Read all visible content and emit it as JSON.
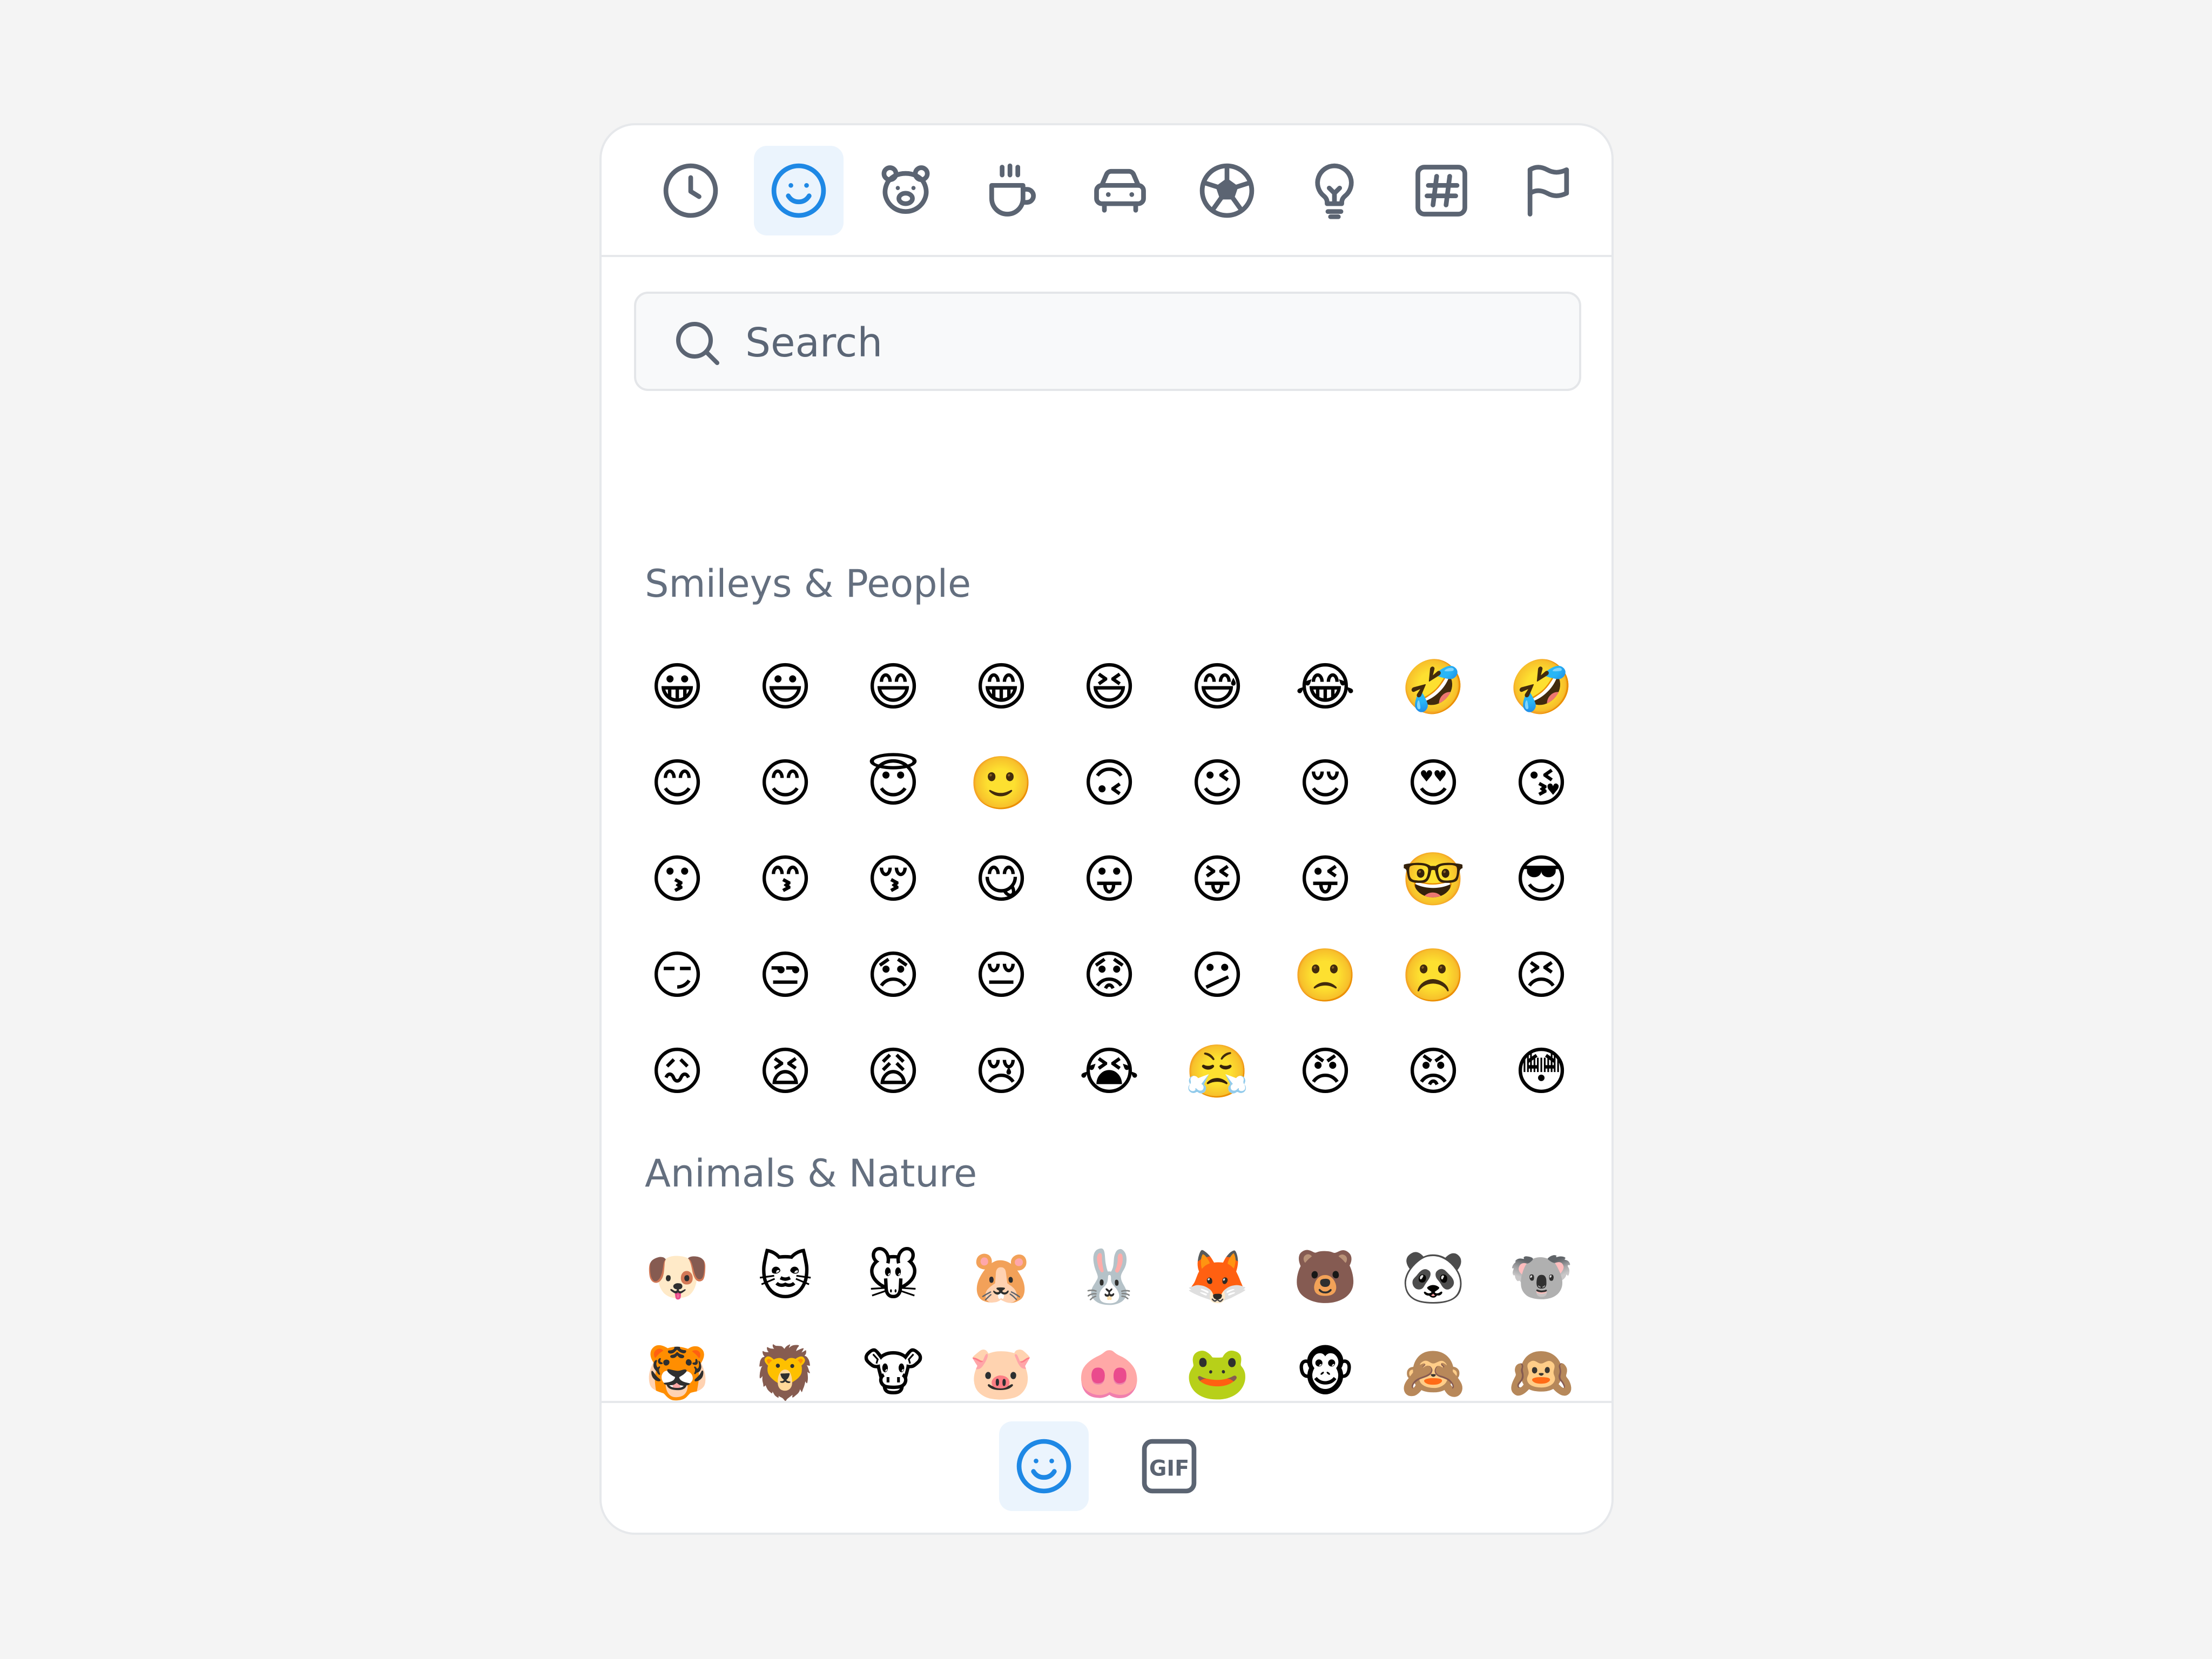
{
  "search": {
    "placeholder": "Search"
  },
  "tabs": [
    {
      "icon": "clock-icon"
    },
    {
      "icon": "smiley-icon",
      "active": true
    },
    {
      "icon": "bear-icon"
    },
    {
      "icon": "coffee-cup-icon"
    },
    {
      "icon": "car-icon"
    },
    {
      "icon": "soccer-ball-icon"
    },
    {
      "icon": "lightbulb-icon"
    },
    {
      "icon": "hashtag-icon"
    },
    {
      "icon": "flag-icon"
    }
  ],
  "sections": [
    {
      "title": "Smileys & People",
      "emojis": [
        "😀",
        "😃",
        "😄",
        "😁",
        "😆",
        "😅",
        "😂",
        "🤣",
        "🤣",
        "😊",
        "😊",
        "😇",
        "🙂",
        "🙃",
        "😉",
        "😌",
        "😍",
        "😘",
        "😗",
        "😙",
        "😚",
        "😋",
        "😛",
        "😝",
        "😜",
        "🤓",
        "😎",
        "😏",
        "😒",
        "😞",
        "😔",
        "😟",
        "😕",
        "🙁",
        "☹️",
        "😣",
        "😖",
        "😫",
        "😩",
        "😢",
        "😭",
        "😤",
        "😠",
        "😡",
        "😳"
      ]
    },
    {
      "title": "Animals & Nature",
      "emojis": [
        "🐶",
        "🐱",
        "🐭",
        "🐹",
        "🐰",
        "🦊",
        "🐻",
        "🐼",
        "🐨",
        "🐯",
        "🦁",
        "🐮",
        "🐷",
        "🐽",
        "🐸",
        "🐵",
        "🙈",
        "🙉",
        "🙊",
        "🐒",
        "🐔",
        "🐧",
        "🐦",
        "🐤",
        "🐣",
        "🐥",
        "🦆"
      ]
    }
  ],
  "bottom_tabs": [
    {
      "icon": "emoji-icon",
      "active": true
    },
    {
      "icon": "gif-icon",
      "label": "GIF"
    }
  ],
  "colors": {
    "accent": "#1e88e5",
    "icon": "#5b6472",
    "active_bg": "#ebf4fd"
  }
}
